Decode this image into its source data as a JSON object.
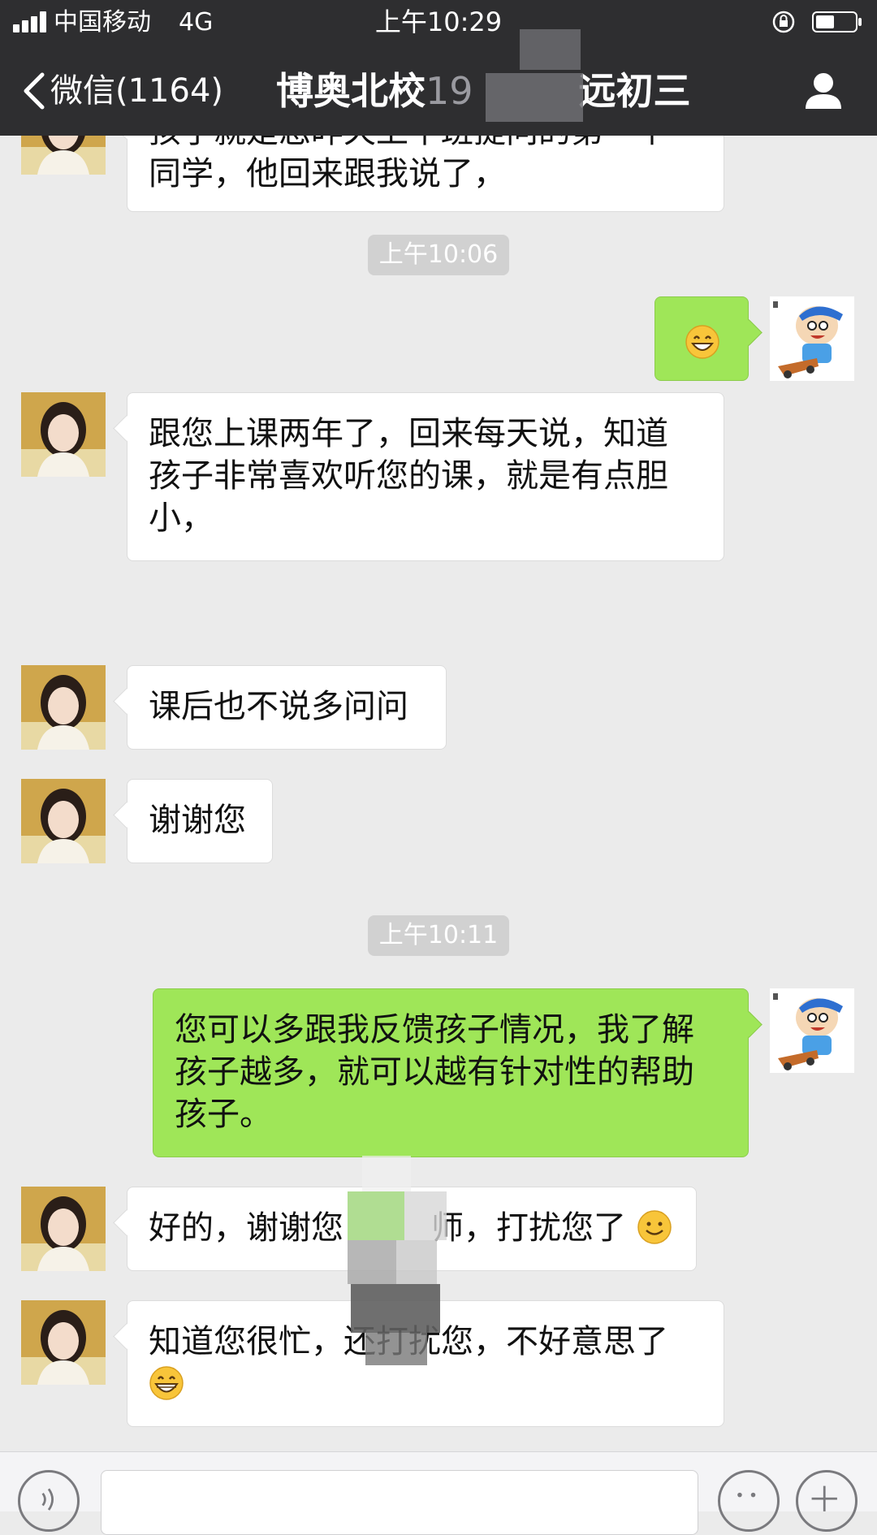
{
  "status_bar": {
    "carrier": "中国移动",
    "network": "4G",
    "time": "上午10:29"
  },
  "nav": {
    "back_label": "微信(1164)",
    "title_part1": "博奥北校",
    "title_part2": "19",
    "title_part3": "远初三"
  },
  "messages": [
    {
      "type": "in",
      "lines": [
        "孩子就是您昨天上午班提问的第一个",
        "同学，他回来跟我说了，"
      ]
    },
    {
      "type": "time",
      "text": "上午10:06"
    },
    {
      "type": "out",
      "emoji": "grin-emoji"
    },
    {
      "type": "in",
      "lines": [
        "跟您上课两年了，回来每天说，知道",
        "孩子非常喜欢听您的课，就是有点胆",
        "小，"
      ]
    },
    {
      "type": "in",
      "lines": [
        "课后也不说多问问"
      ]
    },
    {
      "type": "in",
      "lines": [
        "谢谢您"
      ]
    },
    {
      "type": "time",
      "text": "上午10:11"
    },
    {
      "type": "out",
      "lines": [
        "您可以多跟我反馈孩子情况，我了解",
        "孩子越多，就可以越有针对性的帮助",
        "孩子。"
      ]
    },
    {
      "type": "in",
      "lines": [
        "好的，谢谢您",
        "师，打扰您了"
      ],
      "emoji": "smile-emoji"
    },
    {
      "type": "in",
      "lines": [
        "知道您很忙，还打扰您，不好意思了"
      ],
      "emoji": "grin-emoji"
    }
  ],
  "colors": {
    "header_bg": "#2e2e30",
    "chat_bg": "#ebebeb",
    "outgoing_bubble": "#9fe658",
    "incoming_bubble": "#ffffff",
    "timestamp_bg": "#d1d1d1"
  },
  "icons": {
    "back": "chevron-left-icon",
    "profile": "person-icon",
    "voice": "voice-icon",
    "emoji": "emoji-icon",
    "plus": "plus-icon"
  }
}
